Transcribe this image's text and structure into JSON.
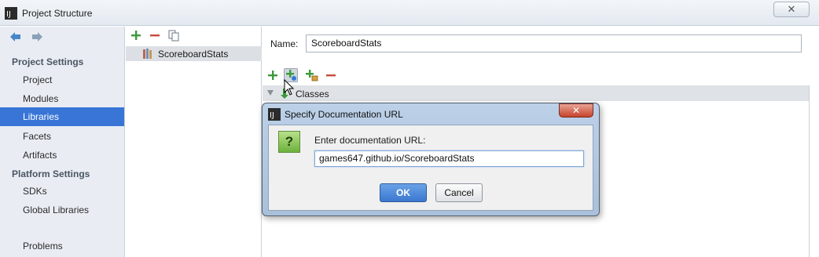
{
  "window": {
    "title": "Project Structure",
    "close_glyph": "✕"
  },
  "sidebar": {
    "nav_back_icon": "arrow-left-icon",
    "nav_forward_icon": "arrow-right-icon",
    "project_settings_header": "Project Settings",
    "platform_settings_header": "Platform Settings",
    "items": [
      {
        "label": "Project"
      },
      {
        "label": "Modules"
      },
      {
        "label": "Libraries",
        "selected": true
      },
      {
        "label": "Facets"
      },
      {
        "label": "Artifacts"
      },
      {
        "label": "SDKs"
      },
      {
        "label": "Global Libraries"
      },
      {
        "label": "Problems"
      }
    ]
  },
  "libraries": {
    "toolbar": [
      "add-icon",
      "remove-icon",
      "copy-icon"
    ],
    "selected_library": "ScoreboardStats"
  },
  "details": {
    "name_label": "Name:",
    "name_value": "ScoreboardStats",
    "toolbar": [
      "add-icon",
      "attach-documentation-icon",
      "add-jar-icon",
      "remove-icon"
    ],
    "classes_label": "Classes"
  },
  "dialog": {
    "title": "Specify Documentation URL",
    "close_glyph": "✕",
    "question_glyph": "?",
    "prompt": "Enter documentation URL:",
    "url_value": "games647.github.io/ScoreboardStats",
    "ok_label": "OK",
    "cancel_label": "Cancel"
  },
  "colors": {
    "selection": "#3875d7",
    "add_green": "#3c9a3c",
    "remove_red": "#c8493b"
  }
}
